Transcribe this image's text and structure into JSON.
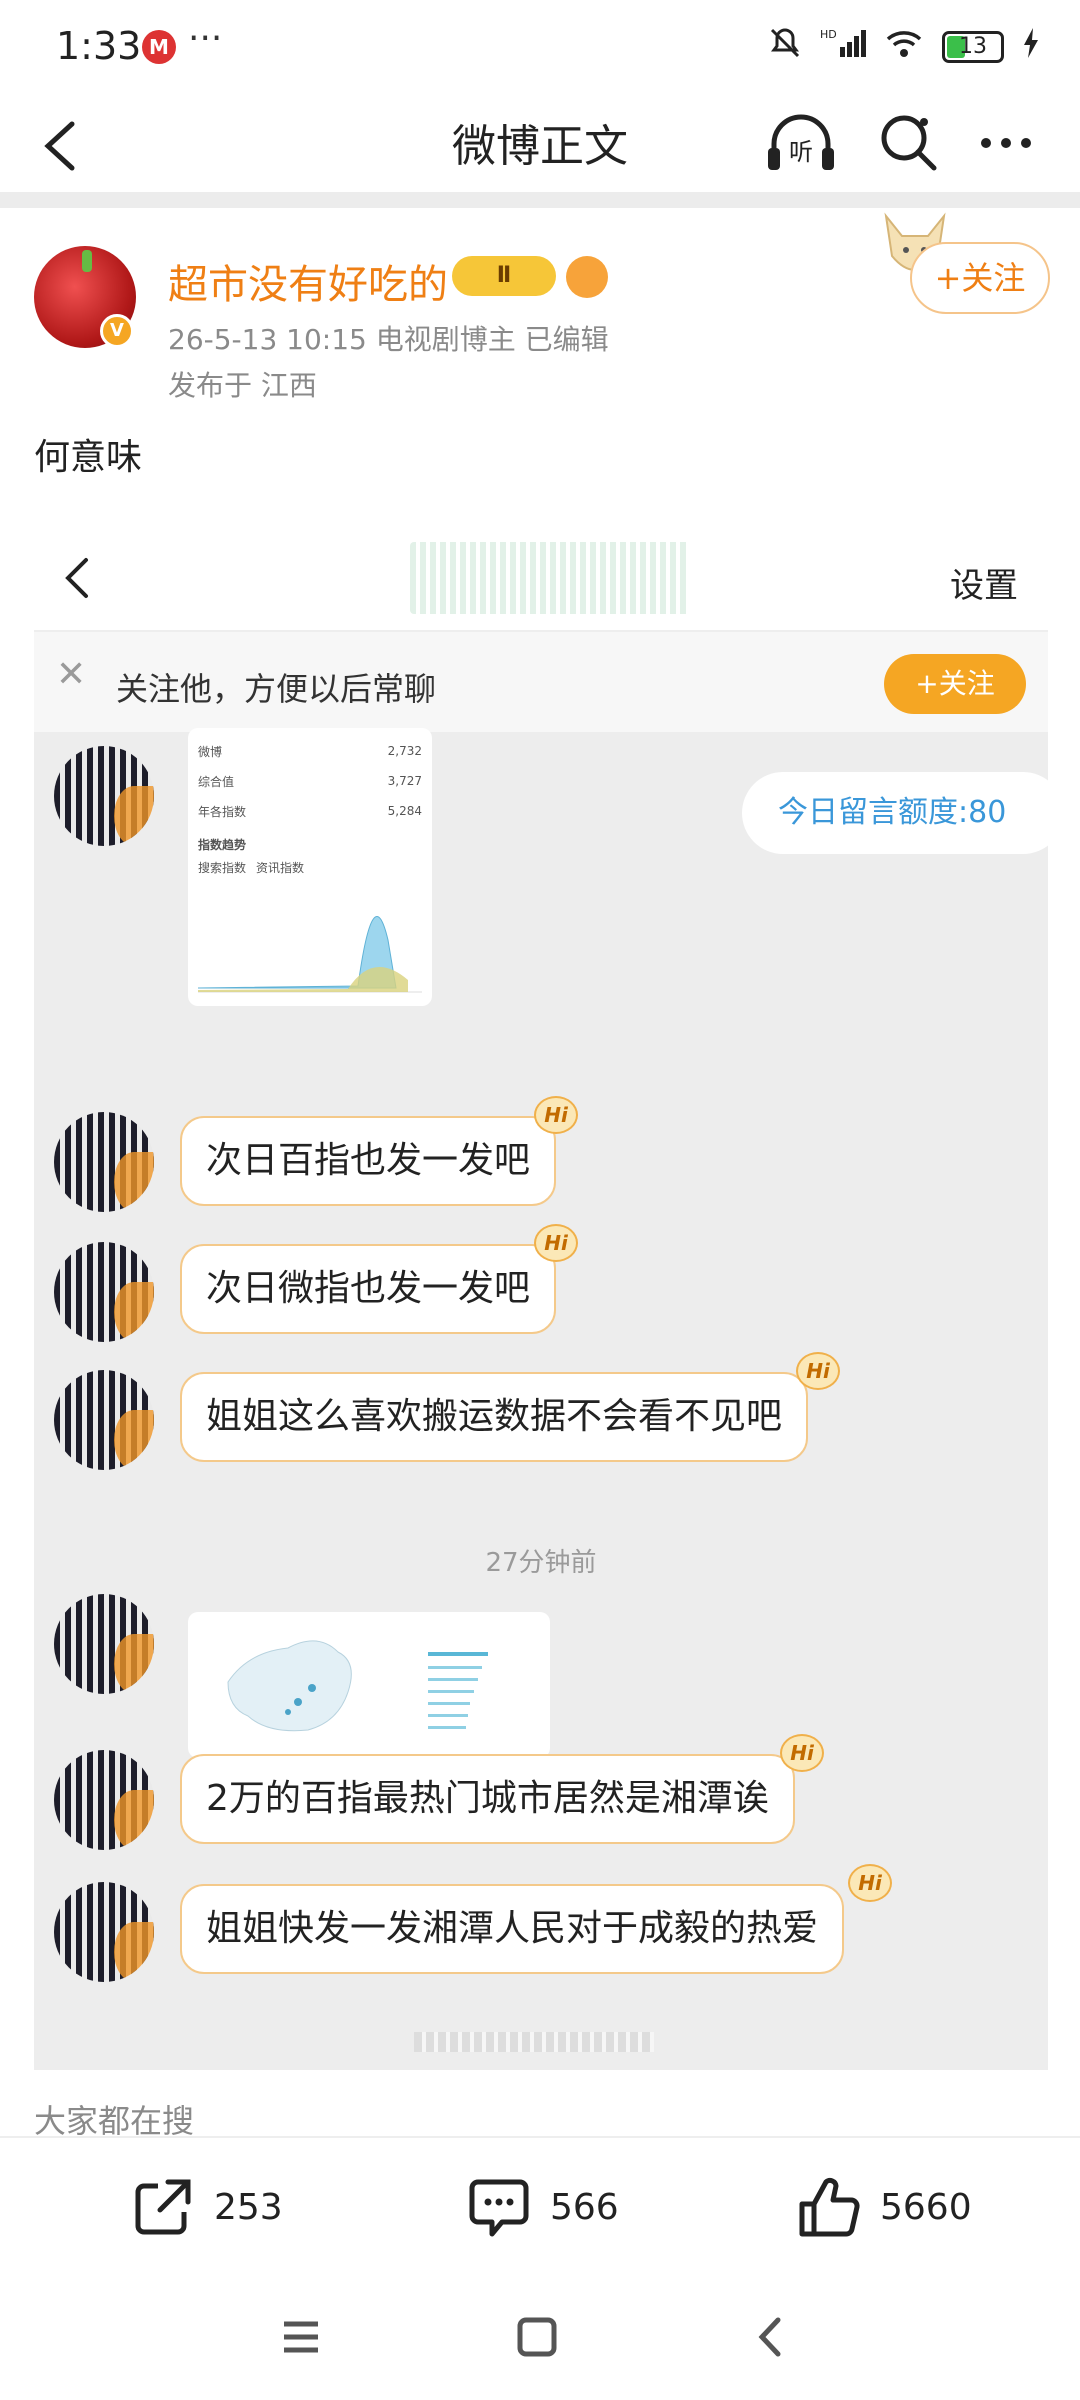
{
  "status_bar": {
    "time": "1:33",
    "carrier_icon": "M",
    "dots": "···",
    "network": "HD",
    "battery": "13"
  },
  "nav": {
    "title": "微博正文",
    "listen_label": "听"
  },
  "post": {
    "username": "超市没有好吃的",
    "vip_label": "Ⅱ",
    "meta": "26-5-13 10:15   电视剧博主   已编辑",
    "location": "发布于 江西",
    "follow_label": "+关注",
    "text": "何意味"
  },
  "embedded": {
    "settings_label": "设置",
    "notice_text": "关注他，方便以后常聊",
    "notice_follow": "+关注",
    "quota_text": "今日留言额度:80",
    "stats_card": {
      "rows": [
        {
          "label": "微博",
          "value": "2,732"
        },
        {
          "label": "综合值",
          "value": "3,727"
        },
        {
          "label": "年各指数",
          "value": "5,284"
        }
      ],
      "section_title": "指数趋势",
      "tabs": [
        "搜索指数",
        "资讯指数"
      ]
    },
    "messages": [
      {
        "text": "次日百指也发一发吧",
        "badge": "Hi"
      },
      {
        "text": "次日微指也发一发吧",
        "badge": "Hi"
      },
      {
        "text": "姐姐这么喜欢搬运数据不会看不见吧",
        "badge": "Hi"
      },
      {
        "text": "2万的百指最热门城市居然是湘潭诶",
        "badge": "Hi"
      },
      {
        "text": "姐姐快发一发湘潭人民对于成毅的热爱",
        "badge": "Hi"
      }
    ],
    "timestamp": "27分钟前"
  },
  "search_hint": "大家都在搜",
  "actions": {
    "repost": "253",
    "comment": "566",
    "like": "5660"
  },
  "colors": {
    "accent": "#ef7f14",
    "follow_btn": "#f5a623",
    "quota_text": "#3a97d9"
  }
}
